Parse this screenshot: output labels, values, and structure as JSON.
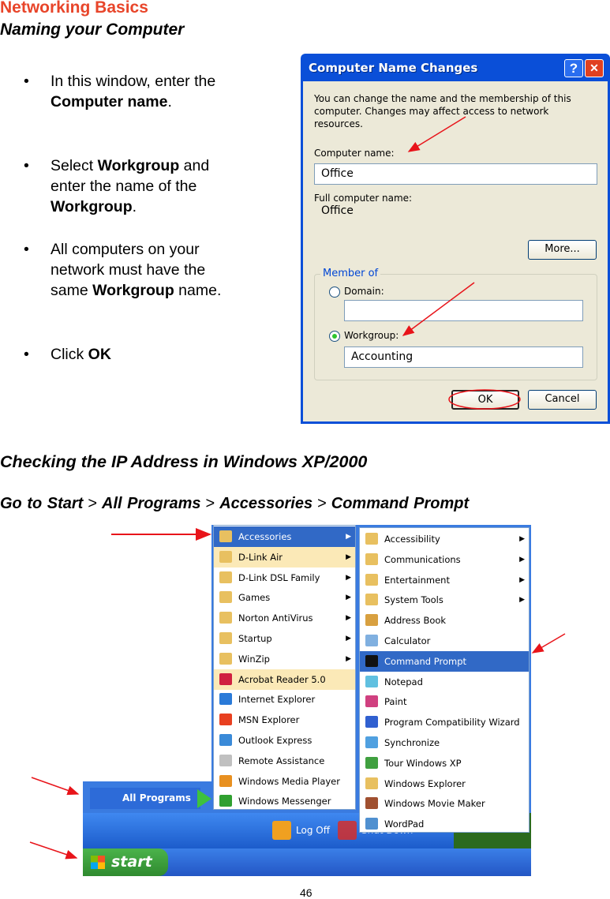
{
  "header": {
    "section": "Networking Basics",
    "title": "Naming your Computer"
  },
  "bullets": [
    {
      "parts": [
        {
          "t": "In this window, enter the ",
          "b": false
        },
        {
          "t": "Computer name",
          "b": true
        },
        {
          "t": ".",
          "b": false
        }
      ]
    },
    {
      "parts": [
        {
          "t": "Select ",
          "b": false
        },
        {
          "t": "Workgroup",
          "b": true
        },
        {
          "t": " and enter the name of the ",
          "b": false
        },
        {
          "t": "Workgroup",
          "b": true
        },
        {
          "t": ".",
          "b": false
        }
      ]
    },
    {
      "parts": [
        {
          "t": "All computers on your network must have the same ",
          "b": false
        },
        {
          "t": "Workgroup",
          "b": true
        },
        {
          "t": " name.",
          "b": false
        }
      ]
    },
    {
      "parts": [
        {
          "t": " Click ",
          "b": false
        },
        {
          "t": "OK",
          "b": true
        }
      ]
    }
  ],
  "bullet_char": "•",
  "dialog": {
    "title": "Computer Name Changes",
    "help": "?",
    "close": "✕",
    "description": "You can change the name and the membership of this computer. Changes may affect access to network resources.",
    "computer_name_label": "Computer name:",
    "computer_name_value": "Office",
    "full_name_label": "Full computer name:",
    "full_name_value": "Office",
    "more_button": "More...",
    "member_of_label": "Member of",
    "domain_label": "Domain:",
    "domain_value": "",
    "domain_selected": false,
    "workgroup_label": "Workgroup:",
    "workgroup_value": "Accounting",
    "workgroup_selected": true,
    "ok_button": "OK",
    "cancel_button": "Cancel"
  },
  "section2": {
    "heading": "Checking the IP Address in Windows XP/2000",
    "path": [
      "Go to Start",
      "All Programs",
      "Accessories",
      "Command Prompt"
    ],
    "separator": ">"
  },
  "start_menu": {
    "all_programs": "All Programs",
    "programs": [
      {
        "label": "Accessories",
        "submenu": true,
        "state": "selected"
      },
      {
        "label": "D-Link Air",
        "submenu": true,
        "state": "new"
      },
      {
        "label": "D-Link DSL Family",
        "submenu": true
      },
      {
        "label": "Games",
        "submenu": true
      },
      {
        "label": "Norton AntiVirus",
        "submenu": true
      },
      {
        "label": "Startup",
        "submenu": true
      },
      {
        "label": "WinZip",
        "submenu": true
      },
      {
        "label": "Acrobat Reader 5.0",
        "submenu": false,
        "state": "new"
      },
      {
        "label": "Internet Explorer",
        "submenu": false
      },
      {
        "label": "MSN Explorer",
        "submenu": false
      },
      {
        "label": "Outlook Express",
        "submenu": false
      },
      {
        "label": "Remote Assistance",
        "submenu": false
      },
      {
        "label": "Windows Media Player",
        "submenu": false
      },
      {
        "label": "Windows Messenger",
        "submenu": false
      }
    ],
    "accessories": [
      {
        "label": "Accessibility",
        "submenu": true
      },
      {
        "label": "Communications",
        "submenu": true
      },
      {
        "label": "Entertainment",
        "submenu": true
      },
      {
        "label": "System Tools",
        "submenu": true
      },
      {
        "label": "Address Book",
        "submenu": false
      },
      {
        "label": "Calculator",
        "submenu": false
      },
      {
        "label": "Command Prompt",
        "submenu": false,
        "state": "selected"
      },
      {
        "label": "Notepad",
        "submenu": false
      },
      {
        "label": "Paint",
        "submenu": false
      },
      {
        "label": "Program Compatibility Wizard",
        "submenu": false
      },
      {
        "label": "Synchronize",
        "submenu": false
      },
      {
        "label": "Tour Windows XP",
        "submenu": false
      },
      {
        "label": "Windows Explorer",
        "submenu": false
      },
      {
        "label": "Windows Movie Maker",
        "submenu": false
      },
      {
        "label": "WordPad",
        "submenu": false
      }
    ],
    "log_off": "Log Off",
    "shut_down": "Shut Down",
    "start": "start"
  },
  "page_number": "46",
  "colors": {
    "section": "#e8452a",
    "annotation": "#e8141a",
    "xp_blue": "#0a4fd8",
    "selected": "#3169c6"
  }
}
